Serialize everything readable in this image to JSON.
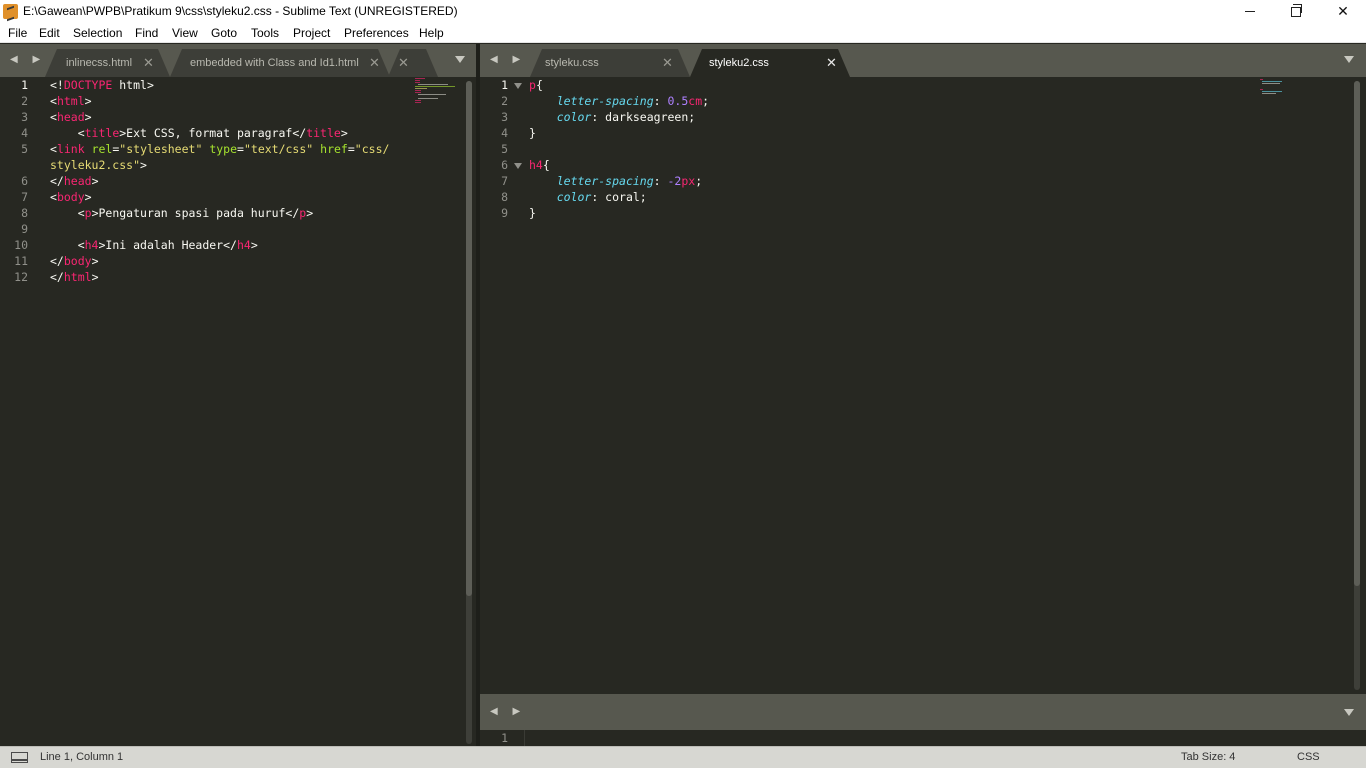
{
  "window": {
    "title": "E:\\Gawean\\PWPB\\Pratikum 9\\css\\styleku2.css - Sublime Text (UNREGISTERED)",
    "controls": {
      "minimize": "—",
      "close": "✕"
    }
  },
  "menu": [
    "File",
    "Edit",
    "Selection",
    "Find",
    "View",
    "Goto",
    "Tools",
    "Project",
    "Preferences",
    "Help"
  ],
  "left_group": {
    "nav": "◀ ▶",
    "tabs": [
      {
        "label": "inlinecss.html",
        "close": "✕"
      },
      {
        "label": "embedded with Class and Id1.html",
        "close": "✕"
      },
      {
        "label": "",
        "close": "✕"
      }
    ],
    "line_numbers": [
      "1",
      "2",
      "3",
      "4",
      "5",
      "",
      "6",
      "7",
      "8",
      "9",
      "10",
      "11",
      "12"
    ],
    "lines": [
      [
        {
          "t": "<!",
          "c": "plain"
        },
        {
          "t": "DOCTYPE",
          "c": "tag"
        },
        {
          "t": " html>",
          "c": "plain"
        }
      ],
      [
        {
          "t": "<",
          "c": "plain"
        },
        {
          "t": "html",
          "c": "tag"
        },
        {
          "t": ">",
          "c": "plain"
        }
      ],
      [
        {
          "t": "<",
          "c": "plain"
        },
        {
          "t": "head",
          "c": "tag"
        },
        {
          "t": ">",
          "c": "plain"
        }
      ],
      [
        {
          "t": "    <",
          "c": "plain"
        },
        {
          "t": "title",
          "c": "tag"
        },
        {
          "t": ">Ext CSS, format paragraf</",
          "c": "plain"
        },
        {
          "t": "title",
          "c": "tag"
        },
        {
          "t": ">",
          "c": "plain"
        }
      ],
      [
        {
          "t": "<",
          "c": "plain"
        },
        {
          "t": "link",
          "c": "tag"
        },
        {
          "t": " ",
          "c": "plain"
        },
        {
          "t": "rel",
          "c": "attr"
        },
        {
          "t": "=",
          "c": "plain"
        },
        {
          "t": "\"stylesheet\"",
          "c": "str"
        },
        {
          "t": " ",
          "c": "plain"
        },
        {
          "t": "type",
          "c": "attr"
        },
        {
          "t": "=",
          "c": "plain"
        },
        {
          "t": "\"text/css\"",
          "c": "str"
        },
        {
          "t": " ",
          "c": "plain"
        },
        {
          "t": "href",
          "c": "attr"
        },
        {
          "t": "=",
          "c": "plain"
        },
        {
          "t": "\"css/",
          "c": "str"
        }
      ],
      [
        {
          "t": "styleku2.css\"",
          "c": "str"
        },
        {
          "t": ">",
          "c": "plain"
        }
      ],
      [
        {
          "t": "</",
          "c": "plain"
        },
        {
          "t": "head",
          "c": "tag"
        },
        {
          "t": ">",
          "c": "plain"
        }
      ],
      [
        {
          "t": "<",
          "c": "plain"
        },
        {
          "t": "body",
          "c": "tag"
        },
        {
          "t": ">",
          "c": "plain"
        }
      ],
      [
        {
          "t": "    <",
          "c": "plain"
        },
        {
          "t": "p",
          "c": "tag"
        },
        {
          "t": ">Pengaturan spasi pada huruf</",
          "c": "plain"
        },
        {
          "t": "p",
          "c": "tag"
        },
        {
          "t": ">",
          "c": "plain"
        }
      ],
      [],
      [
        {
          "t": "    <",
          "c": "plain"
        },
        {
          "t": "h4",
          "c": "tag"
        },
        {
          "t": ">Ini adalah Header</",
          "c": "plain"
        },
        {
          "t": "h4",
          "c": "tag"
        },
        {
          "t": ">",
          "c": "plain"
        }
      ],
      [
        {
          "t": "</",
          "c": "plain"
        },
        {
          "t": "body",
          "c": "tag"
        },
        {
          "t": ">",
          "c": "plain"
        }
      ],
      [
        {
          "t": "</",
          "c": "plain"
        },
        {
          "t": "html",
          "c": "tag"
        },
        {
          "t": ">",
          "c": "plain"
        }
      ]
    ]
  },
  "right_group": {
    "nav": "◀ ▶",
    "tabs": [
      {
        "label": "styleku.css",
        "close": "✕"
      },
      {
        "label": "styleku2.css",
        "close": "✕"
      }
    ],
    "line_numbers": [
      "1",
      "2",
      "3",
      "4",
      "5",
      "6",
      "7",
      "8",
      "9"
    ],
    "lines": [
      [
        {
          "t": "p",
          "c": "sel"
        },
        {
          "t": "{",
          "c": "plain"
        }
      ],
      [
        {
          "t": "    ",
          "c": "plain"
        },
        {
          "t": "letter-spacing",
          "c": "prop"
        },
        {
          "t": ": ",
          "c": "plain"
        },
        {
          "t": "0.5",
          "c": "num"
        },
        {
          "t": "cm",
          "c": "unit"
        },
        {
          "t": ";",
          "c": "plain"
        }
      ],
      [
        {
          "t": "    ",
          "c": "plain"
        },
        {
          "t": "color",
          "c": "prop"
        },
        {
          "t": ": darkseagreen;",
          "c": "plain"
        }
      ],
      [
        {
          "t": "}",
          "c": "plain"
        }
      ],
      [],
      [
        {
          "t": "h4",
          "c": "sel"
        },
        {
          "t": "{",
          "c": "plain"
        }
      ],
      [
        {
          "t": "    ",
          "c": "plain"
        },
        {
          "t": "letter-spacing",
          "c": "prop"
        },
        {
          "t": ": ",
          "c": "plain"
        },
        {
          "t": "-2",
          "c": "num"
        },
        {
          "t": "px",
          "c": "unit"
        },
        {
          "t": ";",
          "c": "plain"
        }
      ],
      [
        {
          "t": "    ",
          "c": "plain"
        },
        {
          "t": "color",
          "c": "prop"
        },
        {
          "t": ": coral;",
          "c": "plain"
        }
      ],
      [
        {
          "t": "}",
          "c": "plain"
        }
      ]
    ]
  },
  "bottom_group": {
    "nav": "◀ ▶",
    "line_number": "1"
  },
  "status": {
    "position": "Line 1, Column 1",
    "tab_size": "Tab Size: 4",
    "syntax": "CSS"
  },
  "colors": {
    "background": "#272822",
    "tag": "#f92672",
    "attribute": "#a6e22e",
    "string": "#e6db74",
    "property": "#66d9ef",
    "number": "#ae81ff"
  }
}
